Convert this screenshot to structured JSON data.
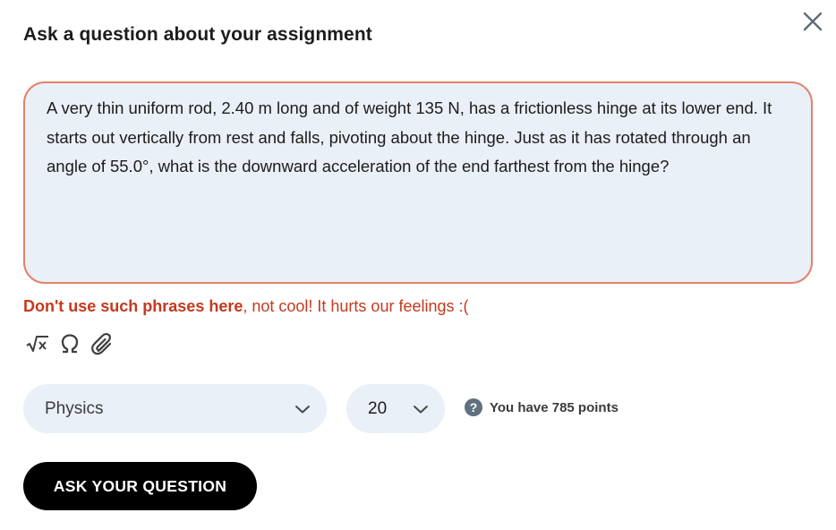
{
  "dialog": {
    "title": "Ask a question about your assignment",
    "close_icon": "close-icon"
  },
  "question": {
    "text": "A very thin uniform rod, 2.40 m long and of weight 135 N, has a frictionless hinge at its lower end. It starts out vertically from rest and falls, pivoting about the hinge. Just as it has rotated through an angle of 55.0°, what is the downward acceleration of the end farthest from the hinge?",
    "border_color": "#e38268",
    "background": "#eaf0f7"
  },
  "warning": {
    "bold": "Don't use such phrases here",
    "rest": ", not cool! It hurts our feelings :(",
    "color": "#c5391d"
  },
  "toolbar": {
    "tools": [
      "square-root-icon",
      "omega-icon",
      "paperclip-icon"
    ]
  },
  "subject": {
    "selected": "Physics"
  },
  "points": {
    "selected": "20",
    "info": "You have 785 points",
    "help_glyph": "?"
  },
  "submit": {
    "label": "ASK YOUR QUESTION"
  }
}
